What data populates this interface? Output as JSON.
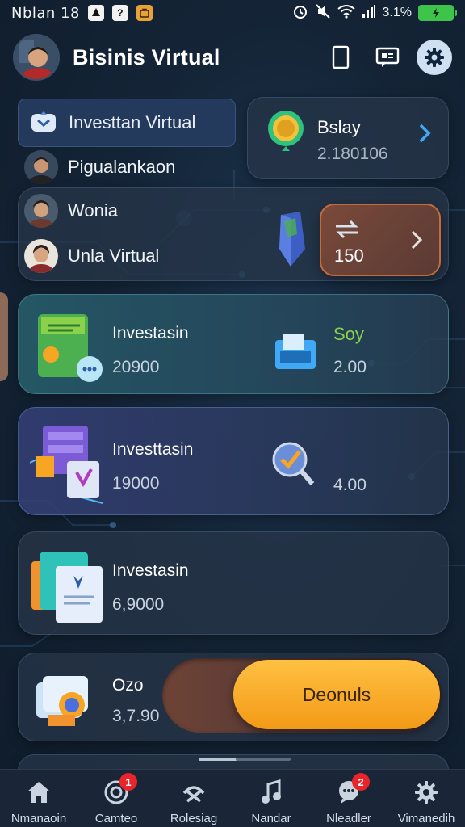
{
  "status_bar": {
    "time": "Nblan 18",
    "app_icon_2_text": "?",
    "battery_text": "3.1%"
  },
  "header": {
    "title": "Bisinis Virtual"
  },
  "menu": {
    "items": [
      {
        "label": "Investtan Virtual"
      },
      {
        "label": "Pigualankaon"
      },
      {
        "label": "Wonia"
      },
      {
        "label": "Unla Virtual"
      }
    ]
  },
  "top_card": {
    "title": "Bslay",
    "value": "2.180106"
  },
  "second_card": {
    "value": "150"
  },
  "investments": [
    {
      "label": "Investasin",
      "value": "20900",
      "right_label": "Soy",
      "right_value": "2.00"
    },
    {
      "label": "Investtasin",
      "value": "19000",
      "right_value": "4.00"
    },
    {
      "label": "Investasin",
      "value": "6,9000"
    }
  ],
  "bottom_card": {
    "label": "Ozo",
    "value": "3,7.90",
    "button_label": "Deonuls"
  },
  "nav": [
    {
      "label": "Nmanaoin",
      "badge": ""
    },
    {
      "label": "Camteo",
      "badge": "1"
    },
    {
      "label": "Rolesiag",
      "badge": ""
    },
    {
      "label": "Nandar",
      "badge": ""
    },
    {
      "label": "Nleadler",
      "badge": "2"
    },
    {
      "label": "Vimanedih",
      "badge": ""
    }
  ],
  "colors": {
    "accent_orange": "#f6a623",
    "accent_green": "#8bd14a",
    "accent_blue": "#3fa9f5",
    "badge_red": "#e8252b",
    "battery_green": "#3ec44a"
  }
}
